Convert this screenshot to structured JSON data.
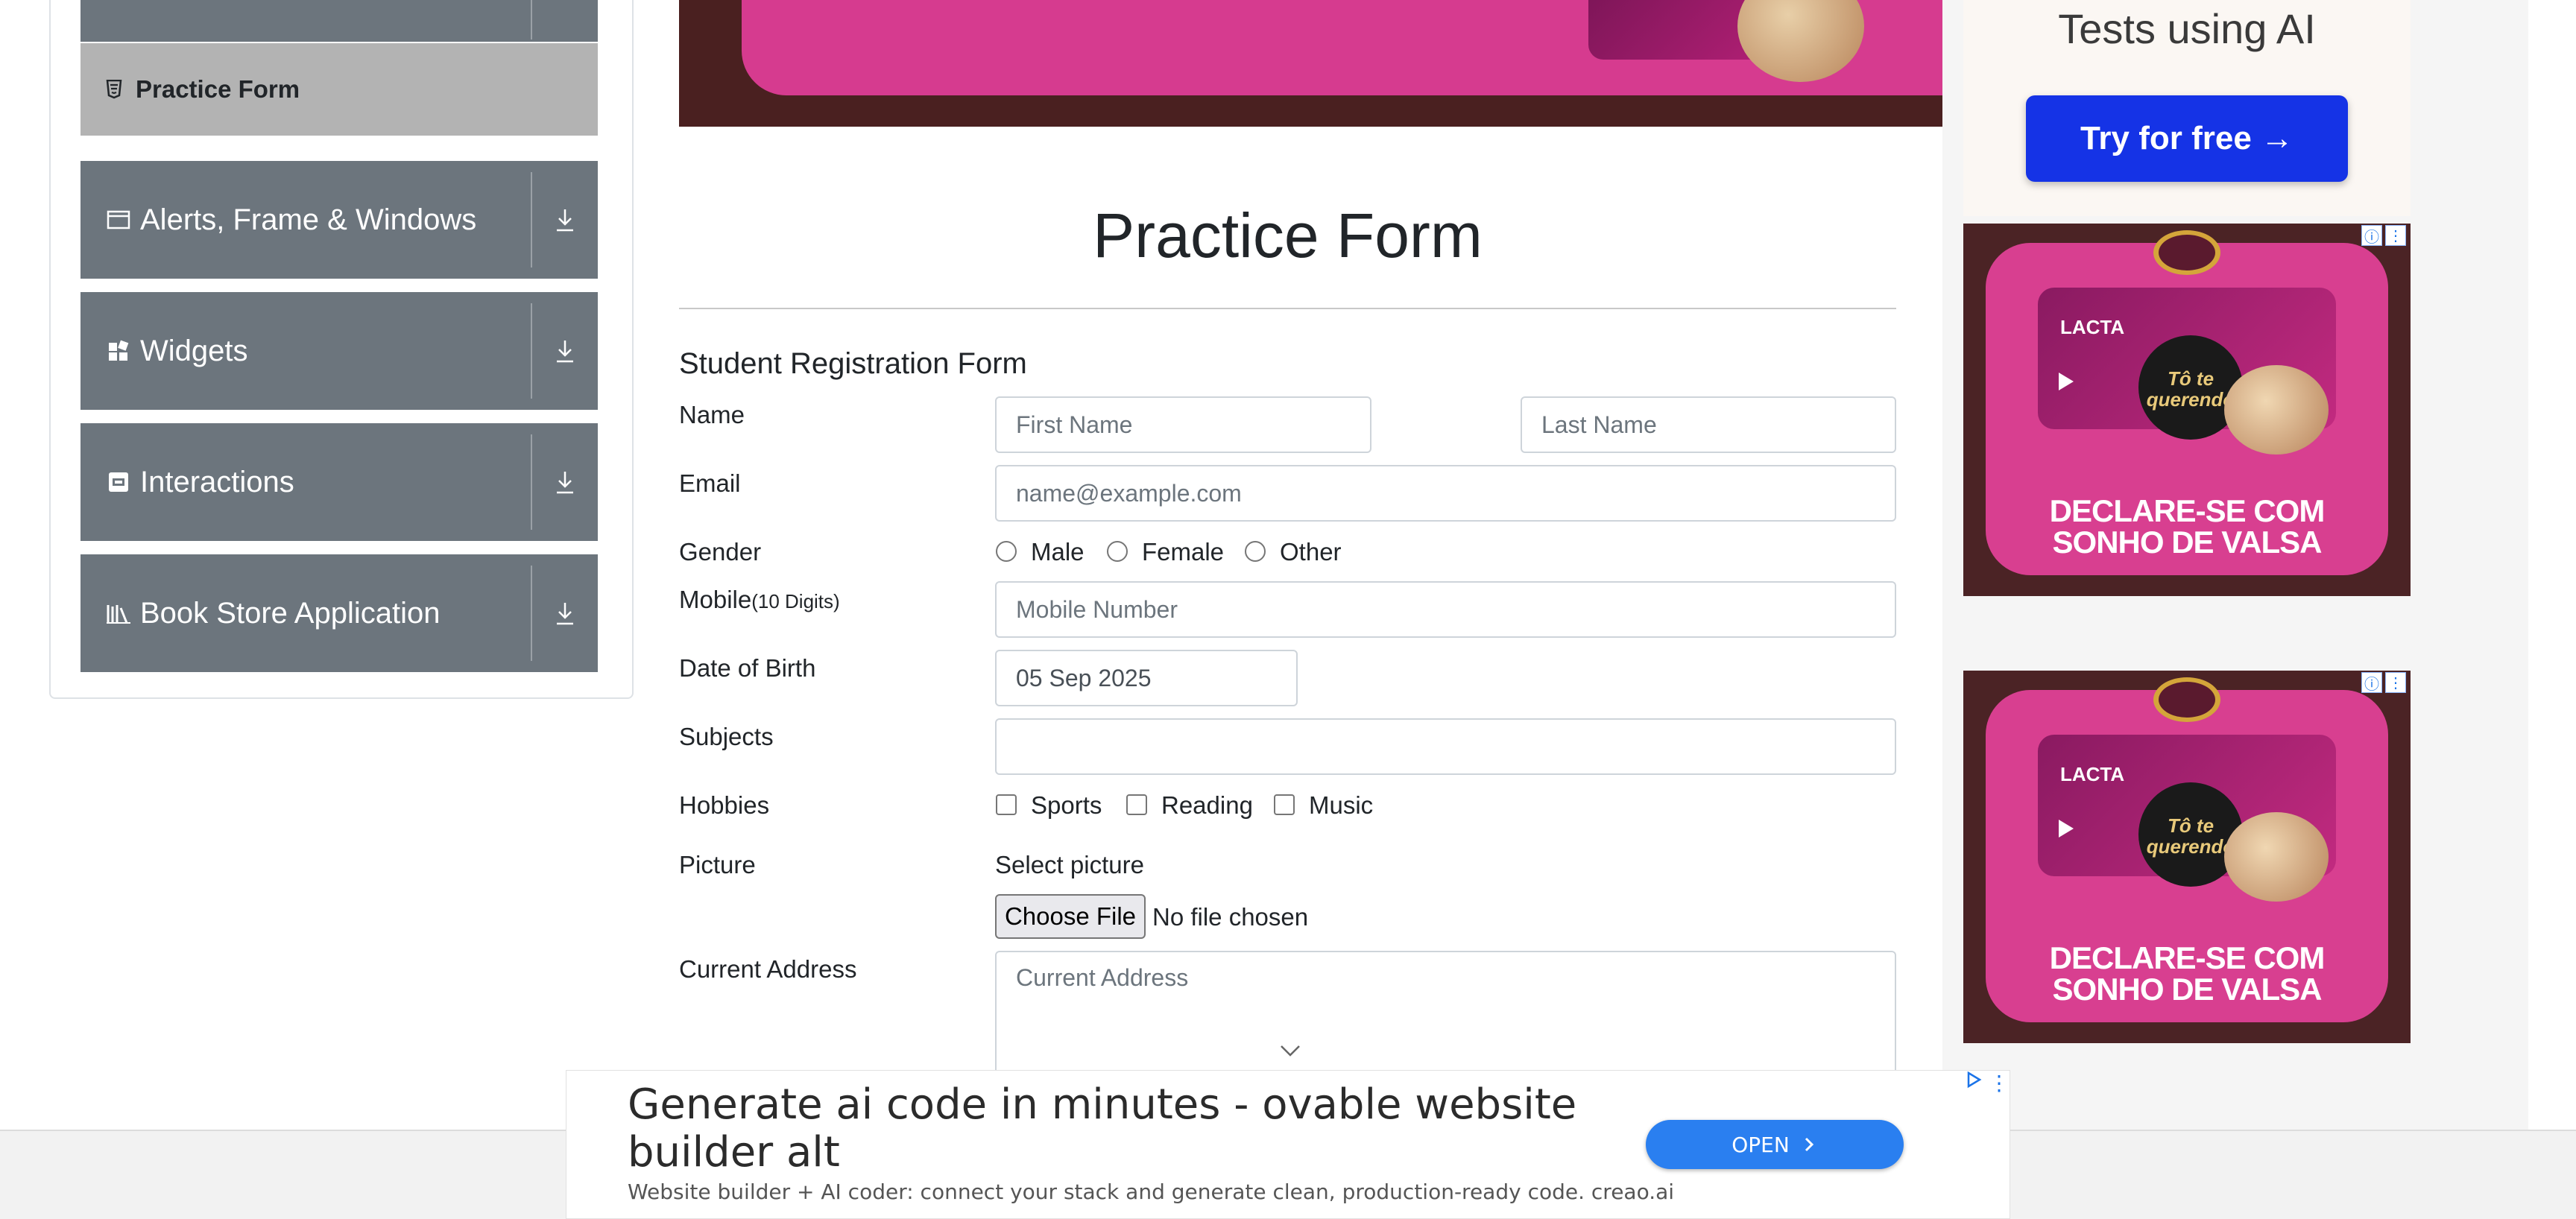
{
  "sidebar": {
    "active_item": {
      "label": "Practice Form",
      "icon": "html5-icon"
    },
    "groups": [
      {
        "label": "Alerts, Frame & Windows",
        "icon": "window-icon"
      },
      {
        "label": "Widgets",
        "icon": "widgets-icon"
      },
      {
        "label": "Interactions",
        "icon": "interactions-icon"
      },
      {
        "label": "Book Store Application",
        "icon": "library-icon"
      }
    ]
  },
  "main": {
    "title": "Practice Form",
    "form_title": "Student Registration Form",
    "name": {
      "label": "Name",
      "first_placeholder": "First Name",
      "last_placeholder": "Last Name"
    },
    "email": {
      "label": "Email",
      "placeholder": "name@example.com"
    },
    "gender": {
      "label": "Gender",
      "options": [
        "Male",
        "Female",
        "Other"
      ]
    },
    "mobile": {
      "label": "Mobile",
      "hint": "(10 Digits)",
      "placeholder": "Mobile Number"
    },
    "dob": {
      "label": "Date of Birth",
      "value": "05 Sep 2025"
    },
    "subjects": {
      "label": "Subjects"
    },
    "hobbies": {
      "label": "Hobbies",
      "options": [
        "Sports",
        "Reading",
        "Music"
      ]
    },
    "picture": {
      "label": "Picture",
      "select_label": "Select picture",
      "button": "Choose File",
      "status": "No file chosen"
    },
    "address": {
      "label": "Current Address",
      "placeholder": "Current Address"
    }
  },
  "ads": {
    "top_right": {
      "text": "Tests using AI",
      "button": "Try for free →"
    },
    "candy": {
      "brand": "LACTA",
      "tagline": "Tô te querendo",
      "slogan_line1": "DECLARE-SE COM",
      "slogan_line2": "SONHO DE VALSA"
    },
    "bottom": {
      "headline": "Generate ai code in minutes - ovable website builder alt",
      "description": "Website builder + AI coder: connect your stack and generate clean, production-ready code. creao.ai",
      "button": "OPEN"
    }
  },
  "colors": {
    "sidebar_group": "#6c757d",
    "active_item": "#b3b3b3",
    "banner_pink": "#d63b8f",
    "ad_button": "#1533e6",
    "open_button": "#2a7ff0"
  }
}
